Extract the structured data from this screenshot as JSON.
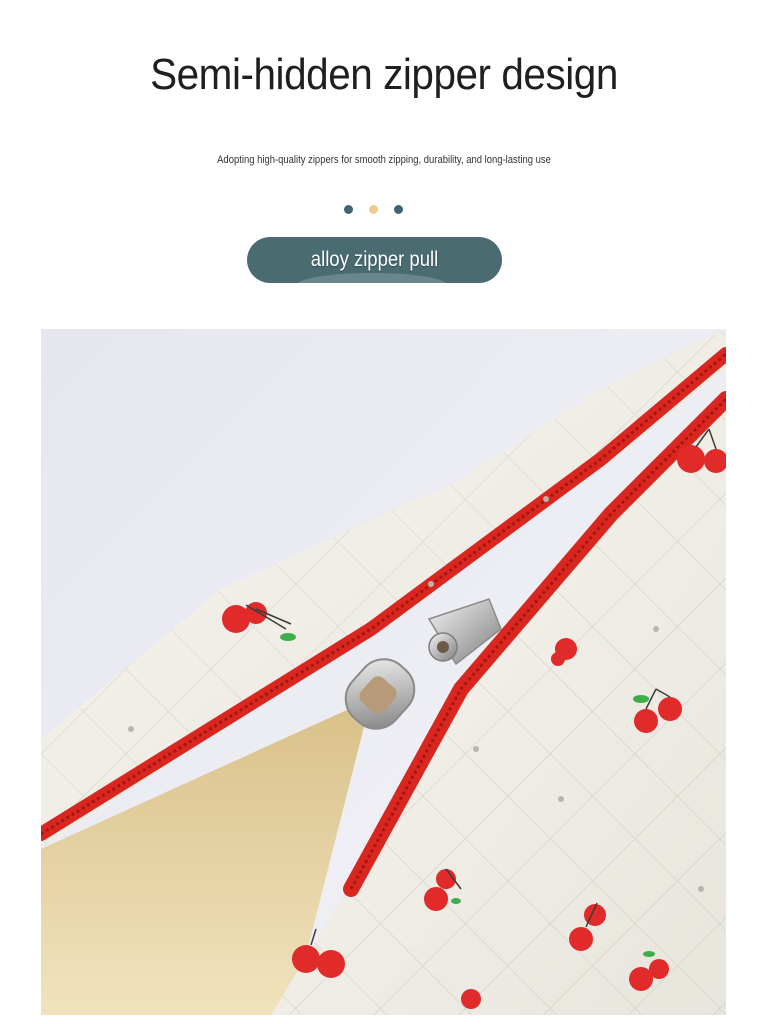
{
  "header": {
    "title": "Semi-hidden zipper design",
    "subtitle": "Adopting high-quality zippers for smooth zipping, durability, and long-lasting use"
  },
  "indicator": {
    "dot_colors": [
      "#3f6570",
      "#f2c98e",
      "#3f6570"
    ]
  },
  "feature_tag": {
    "label": "alloy zipper pull"
  },
  "colors": {
    "tag_background": "#4a6c71",
    "title_text": "#1f1f1f",
    "zipper_red": "#d9271f",
    "cherry_red": "#e12a2a",
    "fabric_white": "#f4f2ec",
    "lining_tan": "#e8d6a8",
    "backdrop": "#e9e9f1"
  }
}
